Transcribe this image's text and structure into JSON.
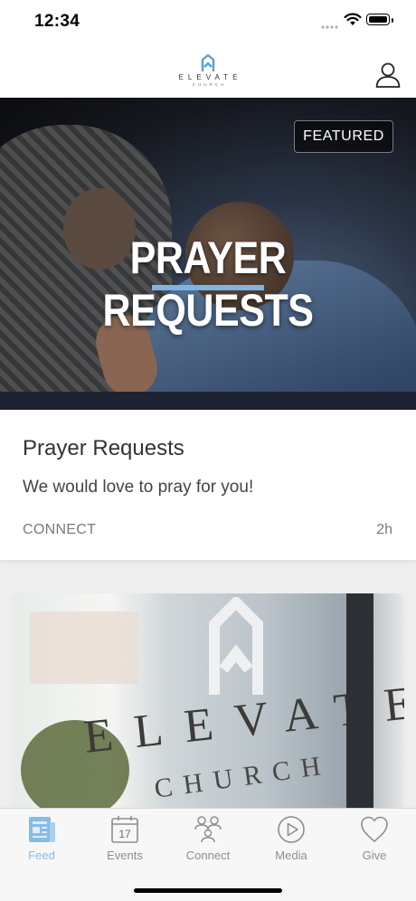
{
  "status_bar": {
    "time": "12:34"
  },
  "header": {
    "logo_text": "ELEVATE",
    "logo_subtext": "CHURCH"
  },
  "featured_post": {
    "image_title": "PRAYER REQUESTS",
    "badge": "FEATURED",
    "title": "Prayer Requests",
    "description": "We would love to pray for you!",
    "category": "CONNECT",
    "age": "2h"
  },
  "second_post": {
    "image_word": "ELEVATE",
    "image_sub": "CHURCH"
  },
  "tab_bar": {
    "tabs": [
      {
        "label": "Feed",
        "icon": "feed-icon",
        "active": true
      },
      {
        "label": "Events",
        "icon": "calendar-icon",
        "active": false,
        "icon_text": "17"
      },
      {
        "label": "Connect",
        "icon": "people-icon",
        "active": false
      },
      {
        "label": "Media",
        "icon": "play-icon",
        "active": false
      },
      {
        "label": "Give",
        "icon": "heart-icon",
        "active": false
      }
    ]
  },
  "colors": {
    "accent": "#87bce6",
    "inactive": "#8e8e8e",
    "hero_bar": "#7fb3e0"
  }
}
